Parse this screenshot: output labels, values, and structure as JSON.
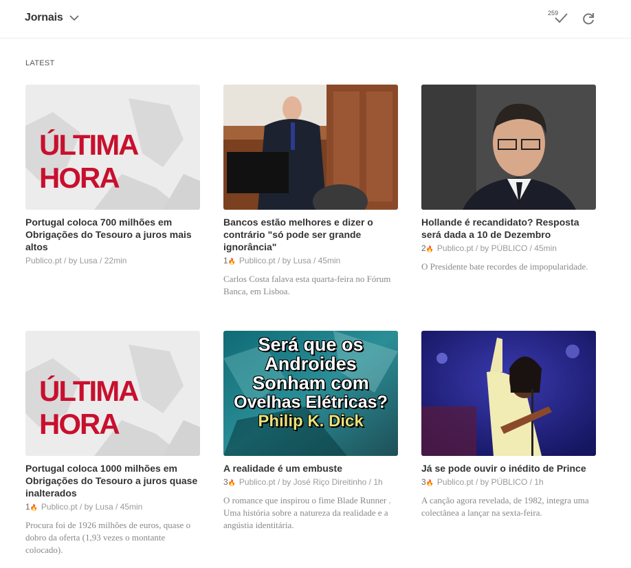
{
  "header": {
    "feed_title": "Jornais",
    "unread_count": "259",
    "icons": {
      "chevron": "chevron-down-icon",
      "mark_read": "checkmark-icon",
      "refresh": "refresh-icon"
    }
  },
  "section": {
    "label": "LATEST"
  },
  "articles": [
    {
      "thumb_text": "ÚLTIMA HORA",
      "title": "Portugal coloca 700 milhões em Obrigações do Tesouro a juros mais altos",
      "engagement": "",
      "meta": "Publico.pt / by Lusa / 22min",
      "summary": ""
    },
    {
      "thumb_text": "",
      "title": "Bancos estão melhores e dizer o contrário \"só pode ser grande ignorância\"",
      "engagement": "1",
      "meta": "Publico.pt / by Lusa / 45min",
      "summary": "Carlos Costa falava esta quarta-feira no Fórum Banca, em Lisboa."
    },
    {
      "thumb_text": "",
      "title": "Hollande é recandidato? Resposta será dada a 10 de Dezembro",
      "engagement": "2",
      "meta": "Publico.pt / by PÚBLICO / 45min",
      "summary": "O Presidente bate recordes de impopularidade."
    },
    {
      "thumb_text": "ÚLTIMA HORA",
      "title": "Portugal coloca 1000 milhões em Obrigações do Tesouro a juros quase inalterados",
      "engagement": "1",
      "meta": "Publico.pt / by Lusa / 45min",
      "summary": "Procura foi de 1926 milhões de euros, quase o dobro da oferta (1,93 vezes o montante colocado)."
    },
    {
      "thumb_text_lines": [
        "Será que os",
        "Androides",
        "Sonham com",
        "Ovelhas Elétricas?",
        "Philip K. Dick"
      ],
      "title": "A realidade é um embuste",
      "engagement": "3",
      "meta": "Publico.pt / by José Riço Direitinho / 1h",
      "summary": "O romance que inspirou o fime Blade Runner . Uma história sobre a natureza da realidade e a angústia identitária."
    },
    {
      "thumb_text": "",
      "title": "Já se pode ouvir o inédito de Prince",
      "engagement": "3",
      "meta": "Publico.pt / by PÚBLICO / 1h",
      "summary": "A canção agora revelada, de 1982, integra uma colectânea a lançar na sexta-feira."
    }
  ],
  "colors": {
    "accent_red": "#c8102e",
    "text": "#333333",
    "meta": "#999999"
  }
}
